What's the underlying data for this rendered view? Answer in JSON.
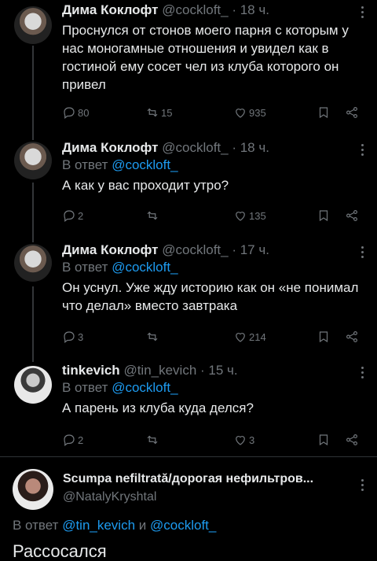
{
  "tweets": [
    {
      "name": "Дима Коклофт",
      "handle": "@cockloft_",
      "time": "· 18 ч.",
      "reply_to_prefix": "",
      "reply_to": "",
      "text": "Проснулся от стонов моего парня с которым у нас моногамные отношения и увидел как в гостиной ему сосет чел из клуба которого он привел",
      "replies": "80",
      "retweets": "15",
      "likes": "935"
    },
    {
      "name": "Дима Коклофт",
      "handle": "@cockloft_",
      "time": "· 18 ч.",
      "reply_to_prefix": "В ответ",
      "reply_to": "@cockloft_",
      "text": "А как у вас проходит утро?",
      "replies": "2",
      "retweets": "",
      "likes": "135"
    },
    {
      "name": "Дима Коклофт",
      "handle": "@cockloft_",
      "time": "· 17 ч.",
      "reply_to_prefix": "В ответ",
      "reply_to": "@cockloft_",
      "text": "Он уснул. Уже жду историю как он «не понимал что делал» вместо завтрака",
      "replies": "3",
      "retweets": "",
      "likes": "214"
    },
    {
      "name": "tinkevich",
      "handle": "@tin_kevich",
      "time": "· 15 ч.",
      "reply_to_prefix": "В ответ",
      "reply_to": "@cockloft_",
      "text": "А парень из клуба куда делся?",
      "replies": "2",
      "retweets": "",
      "likes": "3"
    }
  ],
  "focus": {
    "name": "Scumpa nefiltrată/дорогая нефильтров...",
    "handle": "@NatalyKryshtal",
    "reply_prefix": "В ответ",
    "reply_user1": "@tin_kevich",
    "reply_and": "и",
    "reply_user2": "@cockloft_",
    "text": "Рассосался"
  },
  "icons": [
    "reply-icon",
    "retweet-icon",
    "like-icon",
    "bookmark-icon",
    "share-icon",
    "more-icon"
  ]
}
